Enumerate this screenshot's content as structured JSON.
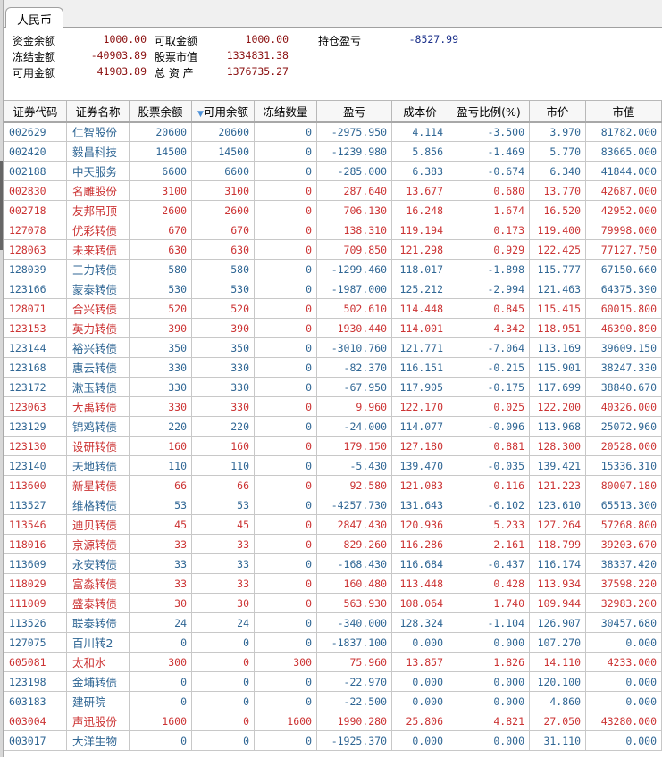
{
  "tab": "人民币",
  "summary": {
    "fund_balance_label": "资金余额",
    "fund_balance": "1000.00",
    "withdrawable_label": "可取金额",
    "withdrawable": "1000.00",
    "position_pnl_label": "持仓盈亏",
    "position_pnl": "-8527.99",
    "frozen_amount_label": "冻结金额",
    "frozen_amount": "-40903.89",
    "stock_value_label": "股票市值",
    "stock_value": "1334831.38",
    "available_label": "可用金额",
    "available": "41903.89",
    "total_assets_label": "总 资 产",
    "total_assets": "1376735.27"
  },
  "columns": [
    "证券代码",
    "证券名称",
    "股票余额",
    "可用余额",
    "冻结数量",
    "盈亏",
    "成本价",
    "盈亏比例(%)",
    "市价",
    "市值"
  ],
  "sorted_column_icon": "sort-desc-triangle",
  "colors": {
    "up": "#cc3333",
    "down": "#2f6694"
  },
  "rows": [
    [
      "002629",
      "仁智股份",
      "20600",
      "20600",
      "0",
      "-2975.950",
      "4.114",
      "-3.500",
      "3.970",
      "81782.000",
      "down"
    ],
    [
      "002420",
      "毅昌科技",
      "14500",
      "14500",
      "0",
      "-1239.980",
      "5.856",
      "-1.469",
      "5.770",
      "83665.000",
      "down"
    ],
    [
      "002188",
      "中天服务",
      "6600",
      "6600",
      "0",
      "-285.000",
      "6.383",
      "-0.674",
      "6.340",
      "41844.000",
      "down"
    ],
    [
      "002830",
      "名雕股份",
      "3100",
      "3100",
      "0",
      "287.640",
      "13.677",
      "0.680",
      "13.770",
      "42687.000",
      "up"
    ],
    [
      "002718",
      "友邦吊顶",
      "2600",
      "2600",
      "0",
      "706.130",
      "16.248",
      "1.674",
      "16.520",
      "42952.000",
      "up"
    ],
    [
      "127078",
      "优彩转债",
      "670",
      "670",
      "0",
      "138.310",
      "119.194",
      "0.173",
      "119.400",
      "79998.000",
      "up"
    ],
    [
      "128063",
      "未来转债",
      "630",
      "630",
      "0",
      "709.850",
      "121.298",
      "0.929",
      "122.425",
      "77127.750",
      "up"
    ],
    [
      "128039",
      "三力转债",
      "580",
      "580",
      "0",
      "-1299.460",
      "118.017",
      "-1.898",
      "115.777",
      "67150.660",
      "down"
    ],
    [
      "123166",
      "蒙泰转债",
      "530",
      "530",
      "0",
      "-1987.000",
      "125.212",
      "-2.994",
      "121.463",
      "64375.390",
      "down"
    ],
    [
      "128071",
      "合兴转债",
      "520",
      "520",
      "0",
      "502.610",
      "114.448",
      "0.845",
      "115.415",
      "60015.800",
      "up"
    ],
    [
      "123153",
      "英力转债",
      "390",
      "390",
      "0",
      "1930.440",
      "114.001",
      "4.342",
      "118.951",
      "46390.890",
      "up"
    ],
    [
      "123144",
      "裕兴转债",
      "350",
      "350",
      "0",
      "-3010.760",
      "121.771",
      "-7.064",
      "113.169",
      "39609.150",
      "down"
    ],
    [
      "123168",
      "惠云转债",
      "330",
      "330",
      "0",
      "-82.370",
      "116.151",
      "-0.215",
      "115.901",
      "38247.330",
      "down"
    ],
    [
      "123172",
      "漱玉转债",
      "330",
      "330",
      "0",
      "-67.950",
      "117.905",
      "-0.175",
      "117.699",
      "38840.670",
      "down"
    ],
    [
      "123063",
      "大禹转债",
      "330",
      "330",
      "0",
      "9.960",
      "122.170",
      "0.025",
      "122.200",
      "40326.000",
      "up"
    ],
    [
      "123129",
      "锦鸡转债",
      "220",
      "220",
      "0",
      "-24.000",
      "114.077",
      "-0.096",
      "113.968",
      "25072.960",
      "down"
    ],
    [
      "123130",
      "设研转债",
      "160",
      "160",
      "0",
      "179.150",
      "127.180",
      "0.881",
      "128.300",
      "20528.000",
      "up"
    ],
    [
      "123140",
      "天地转债",
      "110",
      "110",
      "0",
      "-5.430",
      "139.470",
      "-0.035",
      "139.421",
      "15336.310",
      "down"
    ],
    [
      "113600",
      "新星转债",
      "66",
      "66",
      "0",
      "92.580",
      "121.083",
      "0.116",
      "121.223",
      "80007.180",
      "up"
    ],
    [
      "113527",
      "维格转债",
      "53",
      "53",
      "0",
      "-4257.730",
      "131.643",
      "-6.102",
      "123.610",
      "65513.300",
      "down"
    ],
    [
      "113546",
      "迪贝转债",
      "45",
      "45",
      "0",
      "2847.430",
      "120.936",
      "5.233",
      "127.264",
      "57268.800",
      "up"
    ],
    [
      "118016",
      "京源转债",
      "33",
      "33",
      "0",
      "829.260",
      "116.286",
      "2.161",
      "118.799",
      "39203.670",
      "up"
    ],
    [
      "113609",
      "永安转债",
      "33",
      "33",
      "0",
      "-168.430",
      "116.684",
      "-0.437",
      "116.174",
      "38337.420",
      "down"
    ],
    [
      "118029",
      "富淼转债",
      "33",
      "33",
      "0",
      "160.480",
      "113.448",
      "0.428",
      "113.934",
      "37598.220",
      "up"
    ],
    [
      "111009",
      "盛泰转债",
      "30",
      "30",
      "0",
      "563.930",
      "108.064",
      "1.740",
      "109.944",
      "32983.200",
      "up"
    ],
    [
      "113526",
      "联泰转债",
      "24",
      "24",
      "0",
      "-340.000",
      "128.324",
      "-1.104",
      "126.907",
      "30457.680",
      "down"
    ],
    [
      "127075",
      "百川转2",
      "0",
      "0",
      "0",
      "-1837.100",
      "0.000",
      "0.000",
      "107.270",
      "0.000",
      "down"
    ],
    [
      "605081",
      "太和水",
      "300",
      "0",
      "300",
      "75.960",
      "13.857",
      "1.826",
      "14.110",
      "4233.000",
      "up"
    ],
    [
      "123198",
      "金埔转债",
      "0",
      "0",
      "0",
      "-22.970",
      "0.000",
      "0.000",
      "120.100",
      "0.000",
      "down"
    ],
    [
      "603183",
      "建研院",
      "0",
      "0",
      "0",
      "-22.500",
      "0.000",
      "0.000",
      "4.860",
      "0.000",
      "down"
    ],
    [
      "003004",
      "声迅股份",
      "1600",
      "0",
      "1600",
      "1990.280",
      "25.806",
      "4.821",
      "27.050",
      "43280.000",
      "up"
    ],
    [
      "003017",
      "大洋生物",
      "0",
      "0",
      "0",
      "-1925.370",
      "0.000",
      "0.000",
      "31.110",
      "0.000",
      "down"
    ]
  ]
}
